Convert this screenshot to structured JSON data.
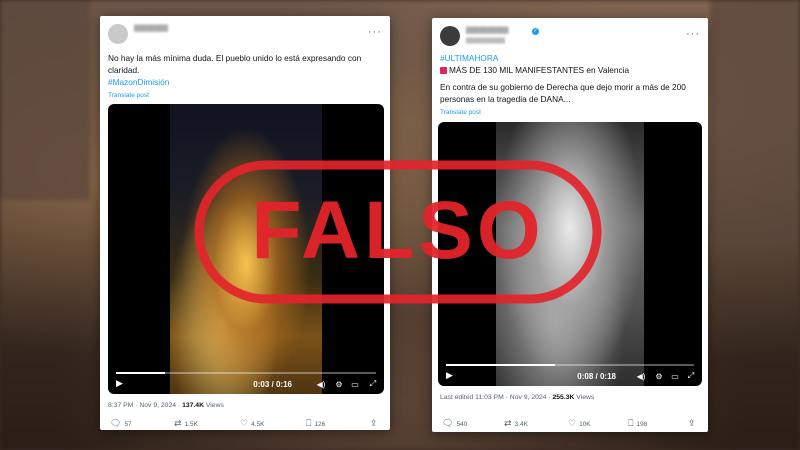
{
  "colors": {
    "accent": "#1d9bf0",
    "stamp": "#e3242b",
    "alert": "#e0245e"
  },
  "stamp": {
    "text": "FALSO"
  },
  "post_left": {
    "text": "No hay la más mínima duda. El pueblo unido lo está expresando con claridad.",
    "hashtag": "#MazonDimisión",
    "translate": "Translate post",
    "video": {
      "time": "0:03 / 0:16",
      "progress": 0.19
    },
    "meta": {
      "time": "8:37 PM",
      "date": "Nov 9, 2024",
      "views_count": "137.4K",
      "views_label": "Views"
    },
    "actions": {
      "replies": "57",
      "reposts": "1.5K",
      "likes": "4.5K",
      "bookmarks": "126"
    },
    "icons": [
      "more-icon",
      "play-icon",
      "volume-icon",
      "settings-icon",
      "fullscreen-icon",
      "reply-icon",
      "repost-icon",
      "like-icon",
      "bookmark-icon",
      "share-icon"
    ]
  },
  "post_right": {
    "hashtag": "#ULTIMAHORA",
    "headline": "MÁS DE 130 MIL MANIFESTANTES en Valencia",
    "body": "En contra de su gobierno de Derecha que dejo morir a más de 200 personas en la tragedia de DANA...",
    "translate": "Translate post",
    "video": {
      "time": "0:08 / 0:18",
      "progress": 0.44
    },
    "meta": {
      "edited": "Last edited 11:03 PM",
      "date": "Nov 9, 2024",
      "views_count": "255.3K",
      "views_label": "Views"
    },
    "actions": {
      "replies": "540",
      "reposts": "3.4K",
      "likes": "10K",
      "bookmarks": "198"
    },
    "icons": [
      "alert-icon",
      "verified-icon",
      "more-icon",
      "play-icon",
      "volume-icon",
      "settings-icon",
      "fullscreen-icon",
      "reply-icon",
      "repost-icon",
      "like-icon",
      "bookmark-icon",
      "share-icon"
    ]
  }
}
